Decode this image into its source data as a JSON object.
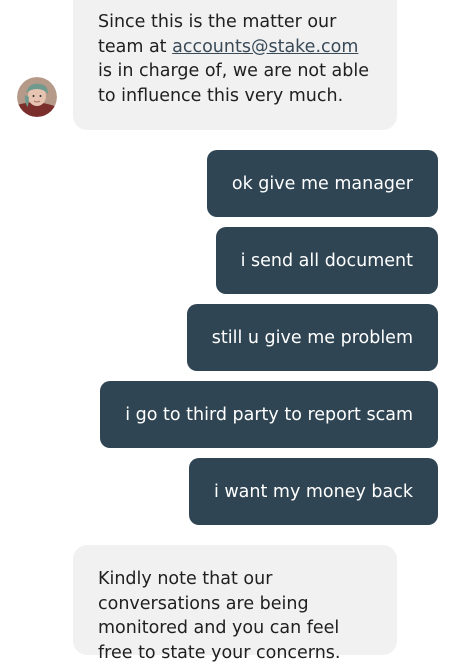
{
  "messages": {
    "agent_1": {
      "text_before_link": "Since this is the matter our team at ",
      "link_text": "accounts@stake.com",
      "text_after_link": " is in charge of, we are not able to influence this very much."
    },
    "user": [
      "ok give me manager",
      "i send all document",
      "still u give me problem",
      "i go to third party to report scam",
      "i want my money back"
    ],
    "agent_2": {
      "text": "Kindly note that our conversations are being monitored and you can feel free to state your concerns."
    }
  },
  "colors": {
    "agent_bubble": "#f1f1f1",
    "user_bubble": "#2f4553",
    "user_text": "#ffffff",
    "link": "#3a4a57"
  },
  "icons": {
    "avatar": "support-agent-avatar"
  }
}
